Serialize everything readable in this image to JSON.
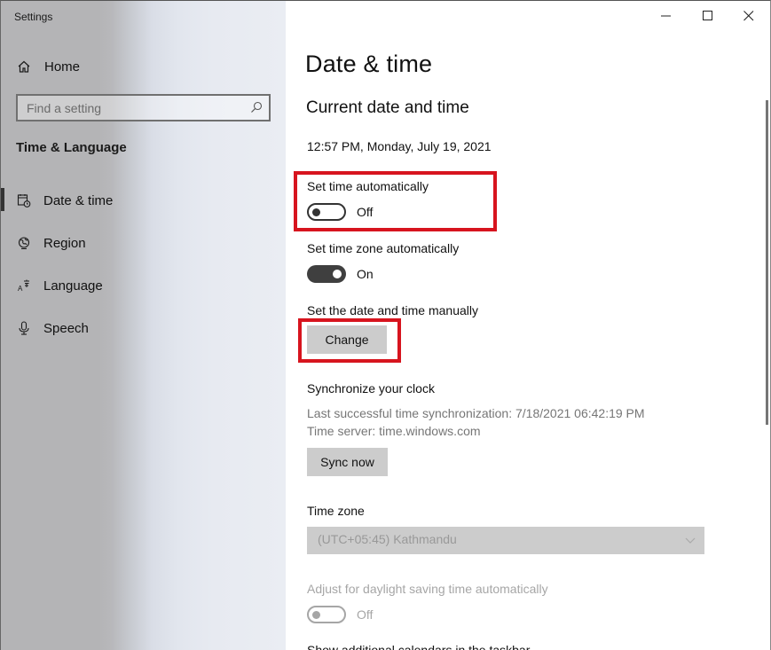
{
  "window": {
    "title": "Settings",
    "controls": {
      "minimize": "minimize-icon",
      "maximize": "maximize-icon",
      "close": "close-icon"
    }
  },
  "sidebar": {
    "home_label": "Home",
    "search_placeholder": "Find a setting",
    "search_value": "",
    "section_title": "Time & Language",
    "items": [
      {
        "label": "Date & time",
        "icon": "calendar-clock-icon",
        "selected": true
      },
      {
        "label": "Region",
        "icon": "globe-region-icon",
        "selected": false
      },
      {
        "label": "Language",
        "icon": "language-icon",
        "selected": false
      },
      {
        "label": "Speech",
        "icon": "microphone-icon",
        "selected": false
      }
    ]
  },
  "main": {
    "page_title": "Date & time",
    "current_heading": "Current date and time",
    "current_datetime": "12:57 PM, Monday, July 19, 2021",
    "set_time_auto": {
      "label": "Set time automatically",
      "state_label": "Off",
      "on": false
    },
    "set_zone_auto": {
      "label": "Set time zone automatically",
      "state_label": "On",
      "on": true
    },
    "manual": {
      "label": "Set the date and time manually",
      "button": "Change"
    },
    "sync": {
      "heading": "Synchronize your clock",
      "last_sync": "Last successful time synchronization: 7/18/2021 06:42:19 PM",
      "server": "Time server: time.windows.com",
      "button": "Sync now"
    },
    "timezone": {
      "label": "Time zone",
      "value": "(UTC+05:45) Kathmandu",
      "disabled": true
    },
    "daylight": {
      "label": "Adjust for daylight saving time automatically",
      "state_label": "Off",
      "on": false,
      "disabled": true
    },
    "calendars_label": "Show additional calendars in the taskbar"
  },
  "annotations": {
    "highlight_color": "#d7141e",
    "highlighted": [
      "set-time-automatically",
      "change-button"
    ]
  }
}
